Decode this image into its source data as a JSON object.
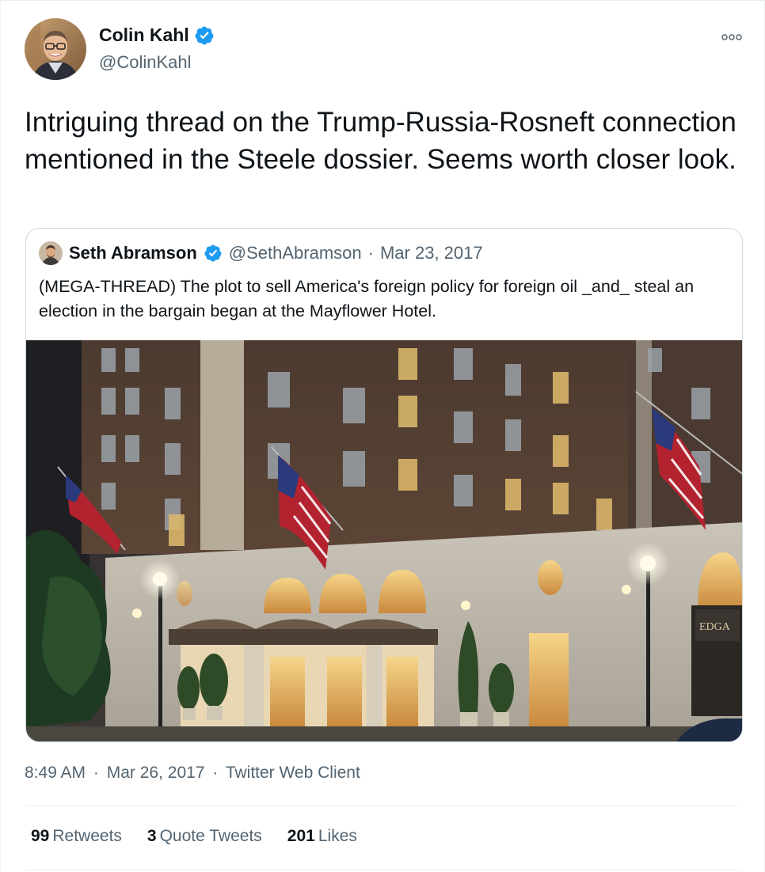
{
  "author": {
    "name": "Colin Kahl",
    "handle": "@ColinKahl"
  },
  "tweet_text": "Intriguing thread on the Trump-Russia-Rosneft connection mentioned in the Steele dossier. Seems worth closer look.",
  "quoted": {
    "name": "Seth Abramson",
    "handle": "@SethAbramson",
    "separator": "·",
    "date": "Mar 23, 2017",
    "text": "(MEGA-THREAD) The plot to sell America's foreign policy for foreign oil _and_ steal an election in the bargain began at the Mayflower Hotel.",
    "image_sign": "EDGA"
  },
  "meta": {
    "time": "8:49 AM",
    "separator": "·",
    "date": "Mar 26, 2017",
    "client": "Twitter Web Client"
  },
  "stats": {
    "retweets_count": "99",
    "retweets_label": "Retweets",
    "quotes_count": "3",
    "quotes_label": "Quote Tweets",
    "likes_count": "201",
    "likes_label": "Likes"
  },
  "icons": {
    "more": "more-icon",
    "verified": "verified-badge-icon"
  },
  "colors": {
    "verified": "#1d9bf0",
    "secondary_text": "#536471",
    "primary_text": "#0f1419",
    "border": "#cfd9de"
  }
}
